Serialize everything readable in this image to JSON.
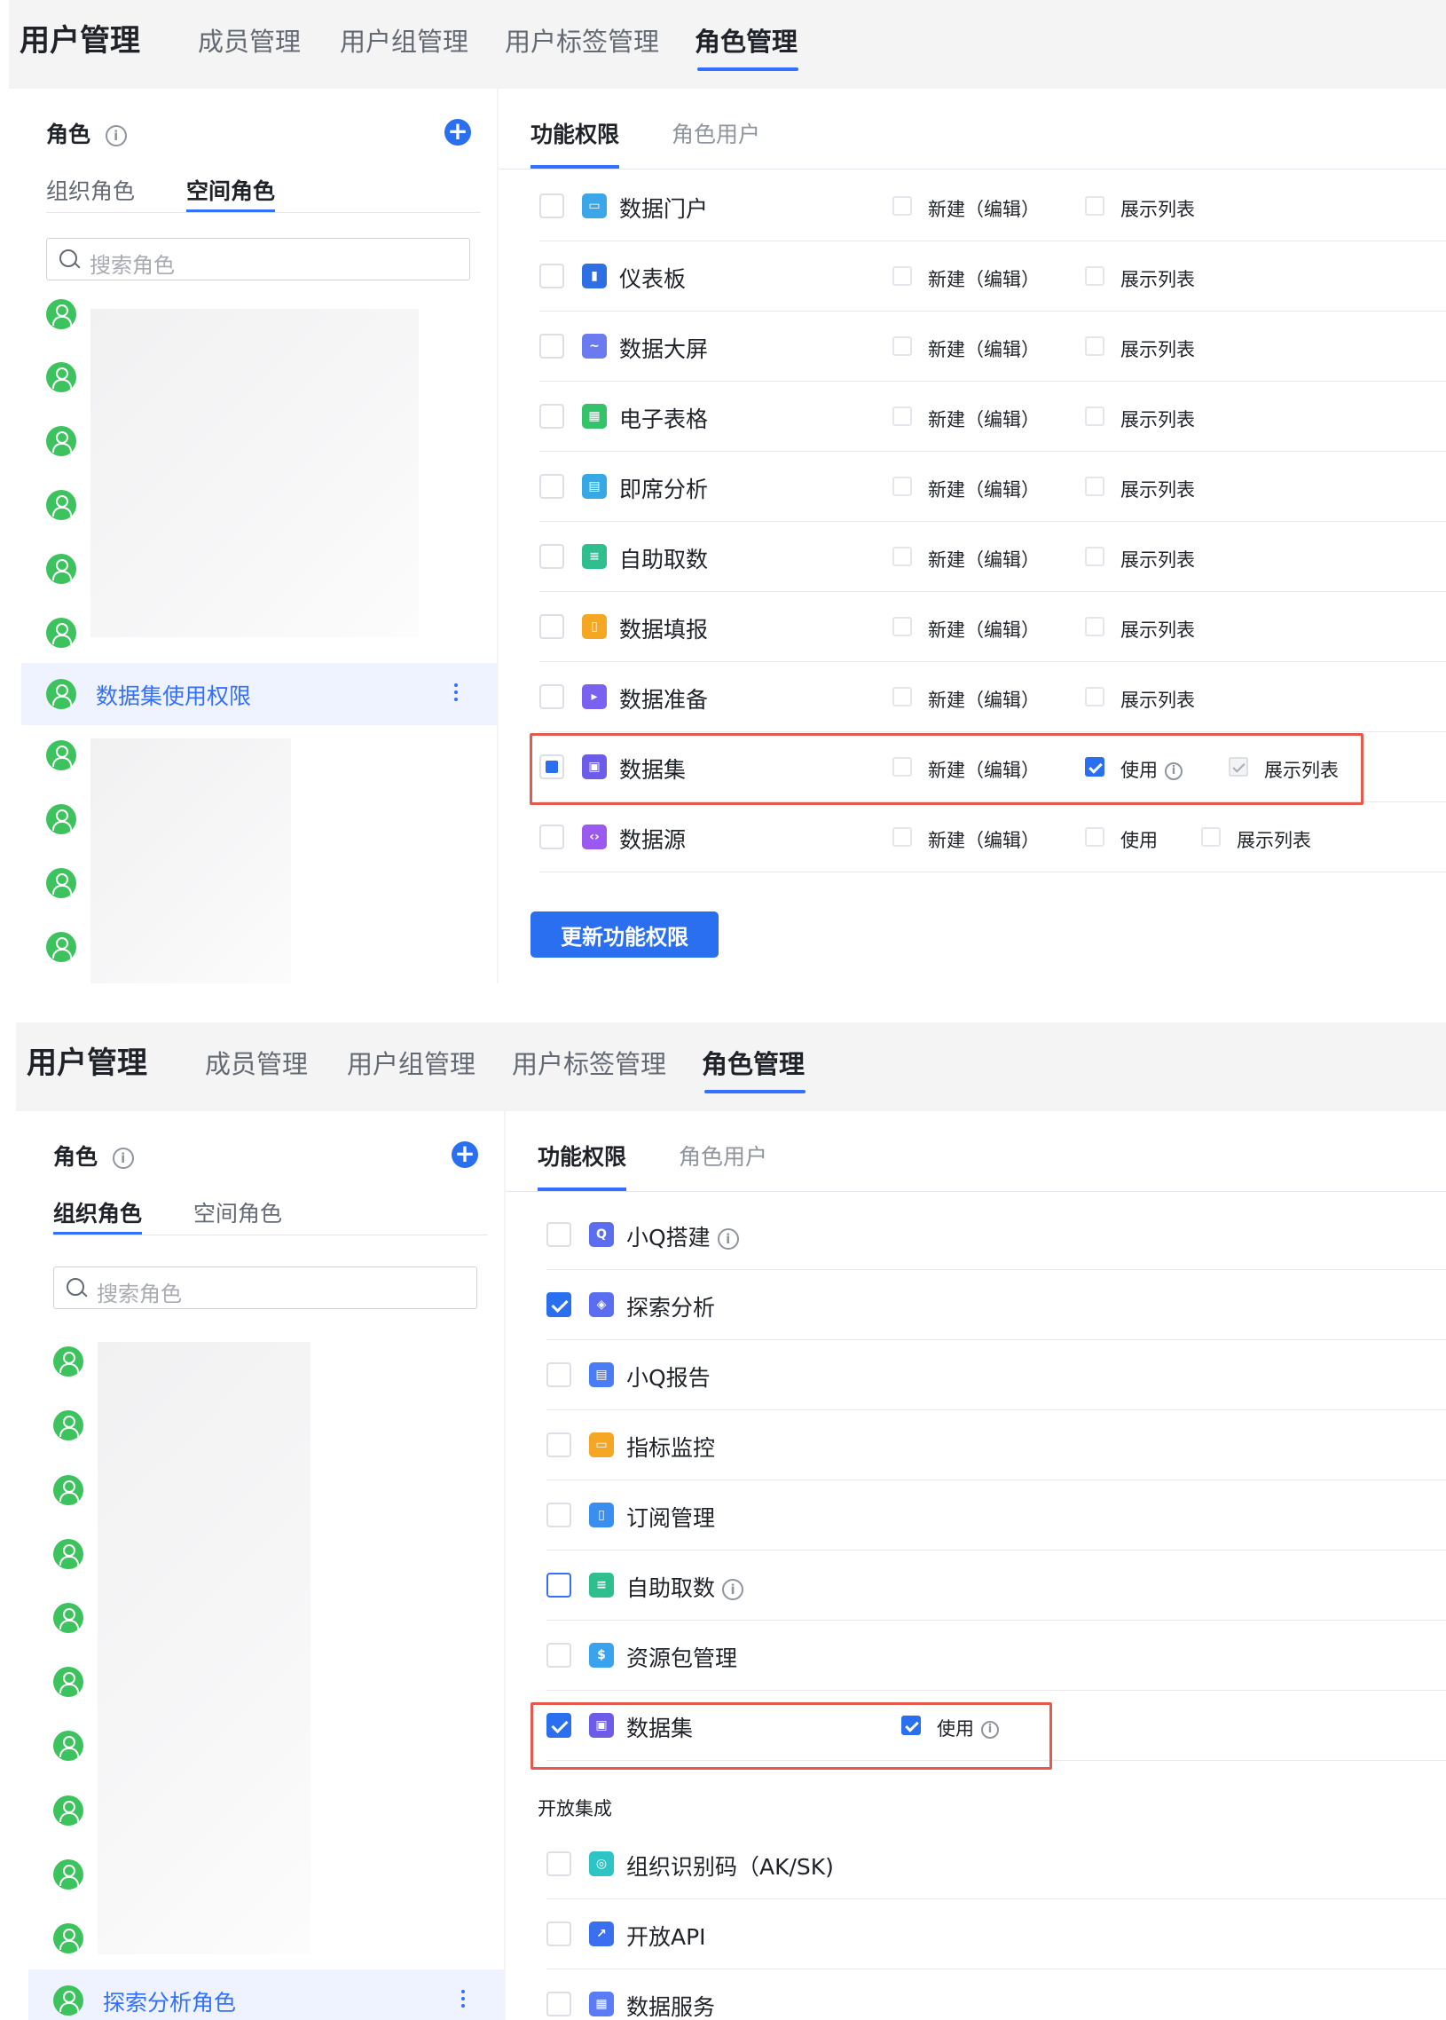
{
  "header": {
    "brand": "用户管理",
    "nav": [
      "成员管理",
      "用户组管理",
      "用户标签管理",
      "角色管理"
    ]
  },
  "sidebar": {
    "title": "角色",
    "search_placeholder": "搜索角色",
    "tabs": [
      "组织角色",
      "空间角色"
    ]
  },
  "main_tabs": [
    "功能权限",
    "角色用户"
  ],
  "panel1": {
    "active_role_tab": "空间角色",
    "selected_role": "数据集使用权限",
    "rows": [
      {
        "label": "数据门户",
        "icon": "portal-icon",
        "color": "#3ba7e8",
        "perms": [
          "新建（编辑）",
          "展示列表"
        ]
      },
      {
        "label": "仪表板",
        "icon": "dashboard-icon",
        "color": "#2f6fe4",
        "perms": [
          "新建（编辑）",
          "展示列表"
        ]
      },
      {
        "label": "数据大屏",
        "icon": "bigscreen-icon",
        "color": "#6a7bf0",
        "perms": [
          "新建（编辑）",
          "展示列表"
        ]
      },
      {
        "label": "电子表格",
        "icon": "spreadsheet-icon",
        "color": "#34c36b",
        "perms": [
          "新建（编辑）",
          "展示列表"
        ]
      },
      {
        "label": "即席分析",
        "icon": "adhoc-analysis-icon",
        "color": "#36a8e6",
        "perms": [
          "新建（编辑）",
          "展示列表"
        ]
      },
      {
        "label": "自助取数",
        "icon": "self-service-fetch-icon",
        "color": "#2fbf8f",
        "perms": [
          "新建（编辑）",
          "展示列表"
        ]
      },
      {
        "label": "数据填报",
        "icon": "data-fill-icon",
        "color": "#f5a623",
        "perms": [
          "新建（编辑）",
          "展示列表"
        ]
      },
      {
        "label": "数据准备",
        "icon": "data-prep-icon",
        "color": "#7b61f0",
        "perms": [
          "新建（编辑）",
          "展示列表"
        ]
      },
      {
        "label": "数据集",
        "icon": "dataset-icon",
        "color": "#6c5ce7",
        "perms": [
          "新建（编辑）",
          "使用",
          "展示列表"
        ]
      },
      {
        "label": "数据源",
        "icon": "datasource-icon",
        "color": "#9b59f0",
        "perms": [
          "新建（编辑）",
          "使用",
          "展示列表"
        ]
      }
    ],
    "update_button": "更新功能权限"
  },
  "panel2": {
    "active_role_tab": "组织角色",
    "selected_role": "探索分析角色",
    "rows": [
      {
        "label": "小Q搭建",
        "icon": "xiaoq-build-icon",
        "color": "#5b6ef0",
        "info": true
      },
      {
        "label": "探索分析",
        "icon": "explore-analysis-icon",
        "color": "#5b6ef0"
      },
      {
        "label": "小Q报告",
        "icon": "xiaoq-report-icon",
        "color": "#4a7cf5"
      },
      {
        "label": "指标监控",
        "icon": "metric-monitor-icon",
        "color": "#f5a623"
      },
      {
        "label": "订阅管理",
        "icon": "subscription-icon",
        "color": "#3a8ef0"
      },
      {
        "label": "自助取数",
        "icon": "self-service-fetch-icon",
        "color": "#2fbf8f",
        "info": true
      },
      {
        "label": "资源包管理",
        "icon": "resource-pack-icon",
        "color": "#3aa3f0"
      },
      {
        "label": "数据集",
        "icon": "dataset-icon",
        "color": "#6c5ce7",
        "perm": "使用"
      }
    ],
    "section": "开放集成",
    "open_rows": [
      {
        "label": "组织识别码（AK/SK)",
        "icon": "org-code-icon",
        "color": "#2ec4c6"
      },
      {
        "label": "开放API",
        "icon": "open-api-icon",
        "color": "#3a6ff0"
      },
      {
        "label": "数据服务",
        "icon": "data-service-icon",
        "color": "#5b7cf5"
      }
    ]
  },
  "colors": {
    "accent": "#3370ff",
    "highlight": "#e45a4f",
    "role_avatar": "#3cc35d"
  }
}
